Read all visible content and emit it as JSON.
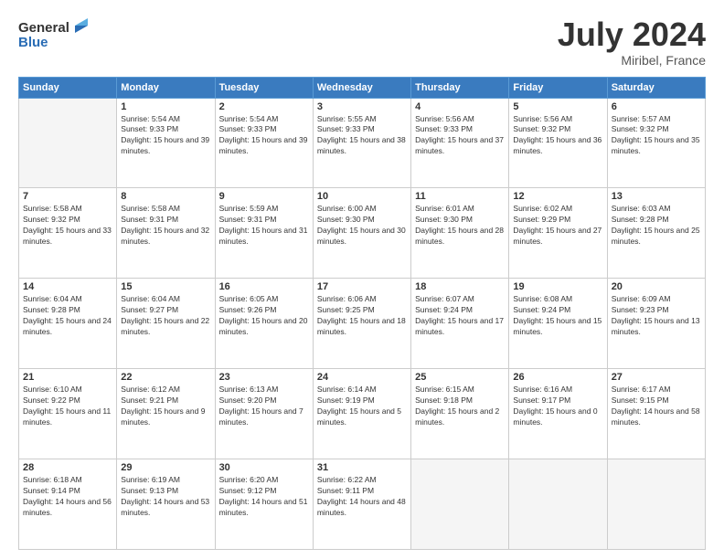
{
  "header": {
    "logo_line1": "General",
    "logo_line2": "Blue",
    "month": "July 2024",
    "location": "Miribel, France"
  },
  "weekdays": [
    "Sunday",
    "Monday",
    "Tuesday",
    "Wednesday",
    "Thursday",
    "Friday",
    "Saturday"
  ],
  "rows": [
    [
      {
        "day": "",
        "empty": true
      },
      {
        "day": "1",
        "sunrise": "5:54 AM",
        "sunset": "9:33 PM",
        "daylight": "15 hours and 39 minutes."
      },
      {
        "day": "2",
        "sunrise": "5:54 AM",
        "sunset": "9:33 PM",
        "daylight": "15 hours and 39 minutes."
      },
      {
        "day": "3",
        "sunrise": "5:55 AM",
        "sunset": "9:33 PM",
        "daylight": "15 hours and 38 minutes."
      },
      {
        "day": "4",
        "sunrise": "5:56 AM",
        "sunset": "9:33 PM",
        "daylight": "15 hours and 37 minutes."
      },
      {
        "day": "5",
        "sunrise": "5:56 AM",
        "sunset": "9:32 PM",
        "daylight": "15 hours and 36 minutes."
      },
      {
        "day": "6",
        "sunrise": "5:57 AM",
        "sunset": "9:32 PM",
        "daylight": "15 hours and 35 minutes."
      }
    ],
    [
      {
        "day": "7",
        "sunrise": "5:58 AM",
        "sunset": "9:32 PM",
        "daylight": "15 hours and 33 minutes."
      },
      {
        "day": "8",
        "sunrise": "5:58 AM",
        "sunset": "9:31 PM",
        "daylight": "15 hours and 32 minutes."
      },
      {
        "day": "9",
        "sunrise": "5:59 AM",
        "sunset": "9:31 PM",
        "daylight": "15 hours and 31 minutes."
      },
      {
        "day": "10",
        "sunrise": "6:00 AM",
        "sunset": "9:30 PM",
        "daylight": "15 hours and 30 minutes."
      },
      {
        "day": "11",
        "sunrise": "6:01 AM",
        "sunset": "9:30 PM",
        "daylight": "15 hours and 28 minutes."
      },
      {
        "day": "12",
        "sunrise": "6:02 AM",
        "sunset": "9:29 PM",
        "daylight": "15 hours and 27 minutes."
      },
      {
        "day": "13",
        "sunrise": "6:03 AM",
        "sunset": "9:28 PM",
        "daylight": "15 hours and 25 minutes."
      }
    ],
    [
      {
        "day": "14",
        "sunrise": "6:04 AM",
        "sunset": "9:28 PM",
        "daylight": "15 hours and 24 minutes."
      },
      {
        "day": "15",
        "sunrise": "6:04 AM",
        "sunset": "9:27 PM",
        "daylight": "15 hours and 22 minutes."
      },
      {
        "day": "16",
        "sunrise": "6:05 AM",
        "sunset": "9:26 PM",
        "daylight": "15 hours and 20 minutes."
      },
      {
        "day": "17",
        "sunrise": "6:06 AM",
        "sunset": "9:25 PM",
        "daylight": "15 hours and 18 minutes."
      },
      {
        "day": "18",
        "sunrise": "6:07 AM",
        "sunset": "9:24 PM",
        "daylight": "15 hours and 17 minutes."
      },
      {
        "day": "19",
        "sunrise": "6:08 AM",
        "sunset": "9:24 PM",
        "daylight": "15 hours and 15 minutes."
      },
      {
        "day": "20",
        "sunrise": "6:09 AM",
        "sunset": "9:23 PM",
        "daylight": "15 hours and 13 minutes."
      }
    ],
    [
      {
        "day": "21",
        "sunrise": "6:10 AM",
        "sunset": "9:22 PM",
        "daylight": "15 hours and 11 minutes."
      },
      {
        "day": "22",
        "sunrise": "6:12 AM",
        "sunset": "9:21 PM",
        "daylight": "15 hours and 9 minutes."
      },
      {
        "day": "23",
        "sunrise": "6:13 AM",
        "sunset": "9:20 PM",
        "daylight": "15 hours and 7 minutes."
      },
      {
        "day": "24",
        "sunrise": "6:14 AM",
        "sunset": "9:19 PM",
        "daylight": "15 hours and 5 minutes."
      },
      {
        "day": "25",
        "sunrise": "6:15 AM",
        "sunset": "9:18 PM",
        "daylight": "15 hours and 2 minutes."
      },
      {
        "day": "26",
        "sunrise": "6:16 AM",
        "sunset": "9:17 PM",
        "daylight": "15 hours and 0 minutes."
      },
      {
        "day": "27",
        "sunrise": "6:17 AM",
        "sunset": "9:15 PM",
        "daylight": "14 hours and 58 minutes."
      }
    ],
    [
      {
        "day": "28",
        "sunrise": "6:18 AM",
        "sunset": "9:14 PM",
        "daylight": "14 hours and 56 minutes."
      },
      {
        "day": "29",
        "sunrise": "6:19 AM",
        "sunset": "9:13 PM",
        "daylight": "14 hours and 53 minutes."
      },
      {
        "day": "30",
        "sunrise": "6:20 AM",
        "sunset": "9:12 PM",
        "daylight": "14 hours and 51 minutes."
      },
      {
        "day": "31",
        "sunrise": "6:22 AM",
        "sunset": "9:11 PM",
        "daylight": "14 hours and 48 minutes."
      },
      {
        "day": "",
        "empty": true
      },
      {
        "day": "",
        "empty": true
      },
      {
        "day": "",
        "empty": true
      }
    ]
  ]
}
